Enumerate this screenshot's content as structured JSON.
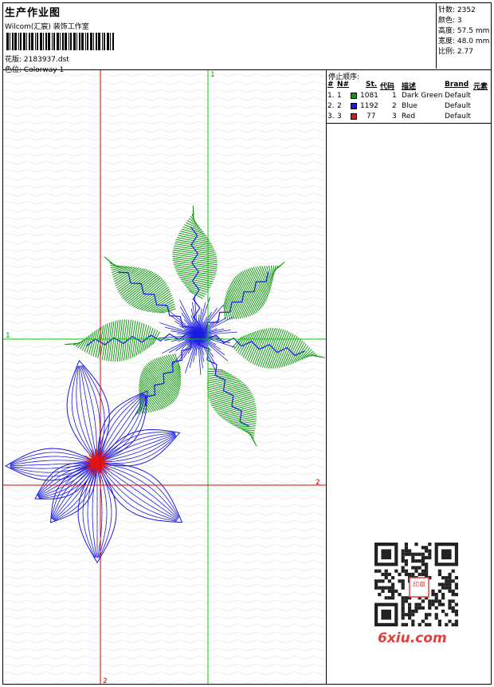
{
  "header": {
    "title": "生产作业图",
    "studio": "Wilcom(汇宸) 装饰工作室",
    "design_label": "花版:",
    "design_file": "2183937.dst",
    "colorway_label": "色位:",
    "colorway": "Colorway 1"
  },
  "stats": [
    {
      "label": "针数:",
      "value": "2352"
    },
    {
      "label": "颜色:",
      "value": "3"
    },
    {
      "label": "高度:",
      "value": "57.5 mm"
    },
    {
      "label": "宽度:",
      "value": "48.0 mm"
    },
    {
      "label": "比例:",
      "value": "2.77"
    }
  ],
  "stop_sequence": {
    "title": "停止顺序:",
    "columns": {
      "index": "#",
      "no": "N#",
      "stitches": "St.",
      "code": "代码",
      "desc": "描述",
      "brand": "Brand",
      "element": "元素"
    },
    "rows": [
      {
        "index": "1.",
        "no": "1",
        "color": "#119911",
        "stitches": "1081",
        "code": "1",
        "desc": "Dark Green",
        "brand": "Default"
      },
      {
        "index": "2.",
        "no": "2",
        "color": "#1a1ae0",
        "stitches": "1192",
        "code": "2",
        "desc": "Blue",
        "brand": "Default"
      },
      {
        "index": "3.",
        "no": "3",
        "color": "#e01515",
        "stitches": "77",
        "code": "3",
        "desc": "Red",
        "brand": "Default"
      }
    ]
  },
  "axes": {
    "green_top": "1",
    "green_left": "1",
    "red_right": "2",
    "red_bottom": "2"
  },
  "colors": {
    "green_axis": "#00cc00",
    "red_axis": "#dd0000",
    "green_thread": "#119911",
    "blue_thread": "#1a1ae0",
    "red_thread": "#e01515",
    "watermark": "#e0403e"
  },
  "watermark": {
    "text": "6xiu.com",
    "qr_stamp": "汉字图章"
  }
}
